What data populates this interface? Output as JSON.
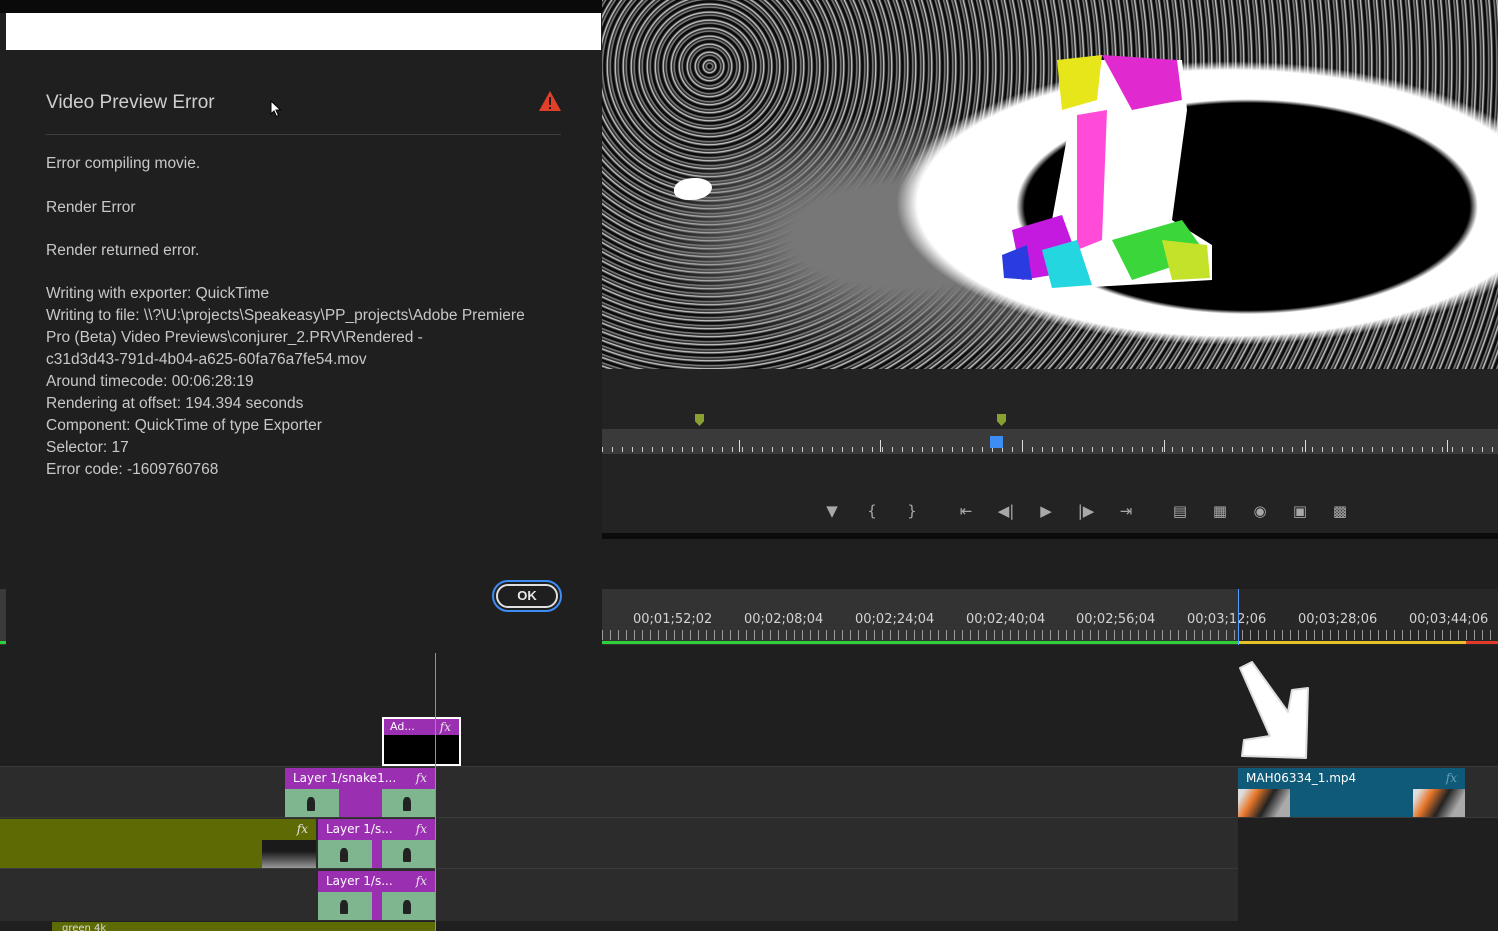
{
  "dialog": {
    "title": "Video Preview Error",
    "messages": [
      "Error compiling movie.",
      "Render Error",
      "Render returned error."
    ],
    "details": [
      "Writing with exporter: QuickTime",
      "Writing to file: \\\\?\\U:\\projects\\Speakeasy\\PP_projects\\Adobe Premiere",
      "Pro (Beta) Video Previews\\conjurer_2.PRV\\Rendered -",
      "c31d3d43-791d-4b04-a625-60fa76a7fe54.mov",
      "Around timecode: 00:06:28:19",
      "Rendering at offset: 194.394 seconds",
      "Component: QuickTime of type Exporter",
      "Selector: 17",
      "Error code: -1609760768"
    ],
    "ok_label": "OK",
    "warning_color": "#e0402a"
  },
  "timeline": {
    "timecodes": [
      "00;01;52;02",
      "00;02;08;04",
      "00;02;24;04",
      "00;02;40;04",
      "00;02;56;04",
      "00;03;12;06",
      "00;03;28;06",
      "00;03;44;06"
    ],
    "clips": {
      "adjustment": "Ad...",
      "snake1": "Layer 1/snake1...",
      "layer2": "Layer 1/s...",
      "layer3": "Layer 1/s...",
      "bottom": "green 4k",
      "mah": "MAH06334_1.mp4"
    },
    "fx_label": "fx",
    "colors": {
      "purple": "#9b2fb1",
      "olive": "#5e6b04",
      "teal": "#0f5a78",
      "playhead": "#4ea0ff"
    }
  },
  "monitor": {
    "transport_icons": [
      "marker-icon",
      "mark-in-icon",
      "mark-out-icon",
      "go-to-in-icon",
      "step-back-icon",
      "play-icon",
      "step-forward-icon",
      "go-to-out-icon",
      "lift-icon",
      "extract-icon",
      "export-frame-icon",
      "comparison-view-icon",
      "proxy-toggle-icon"
    ]
  }
}
